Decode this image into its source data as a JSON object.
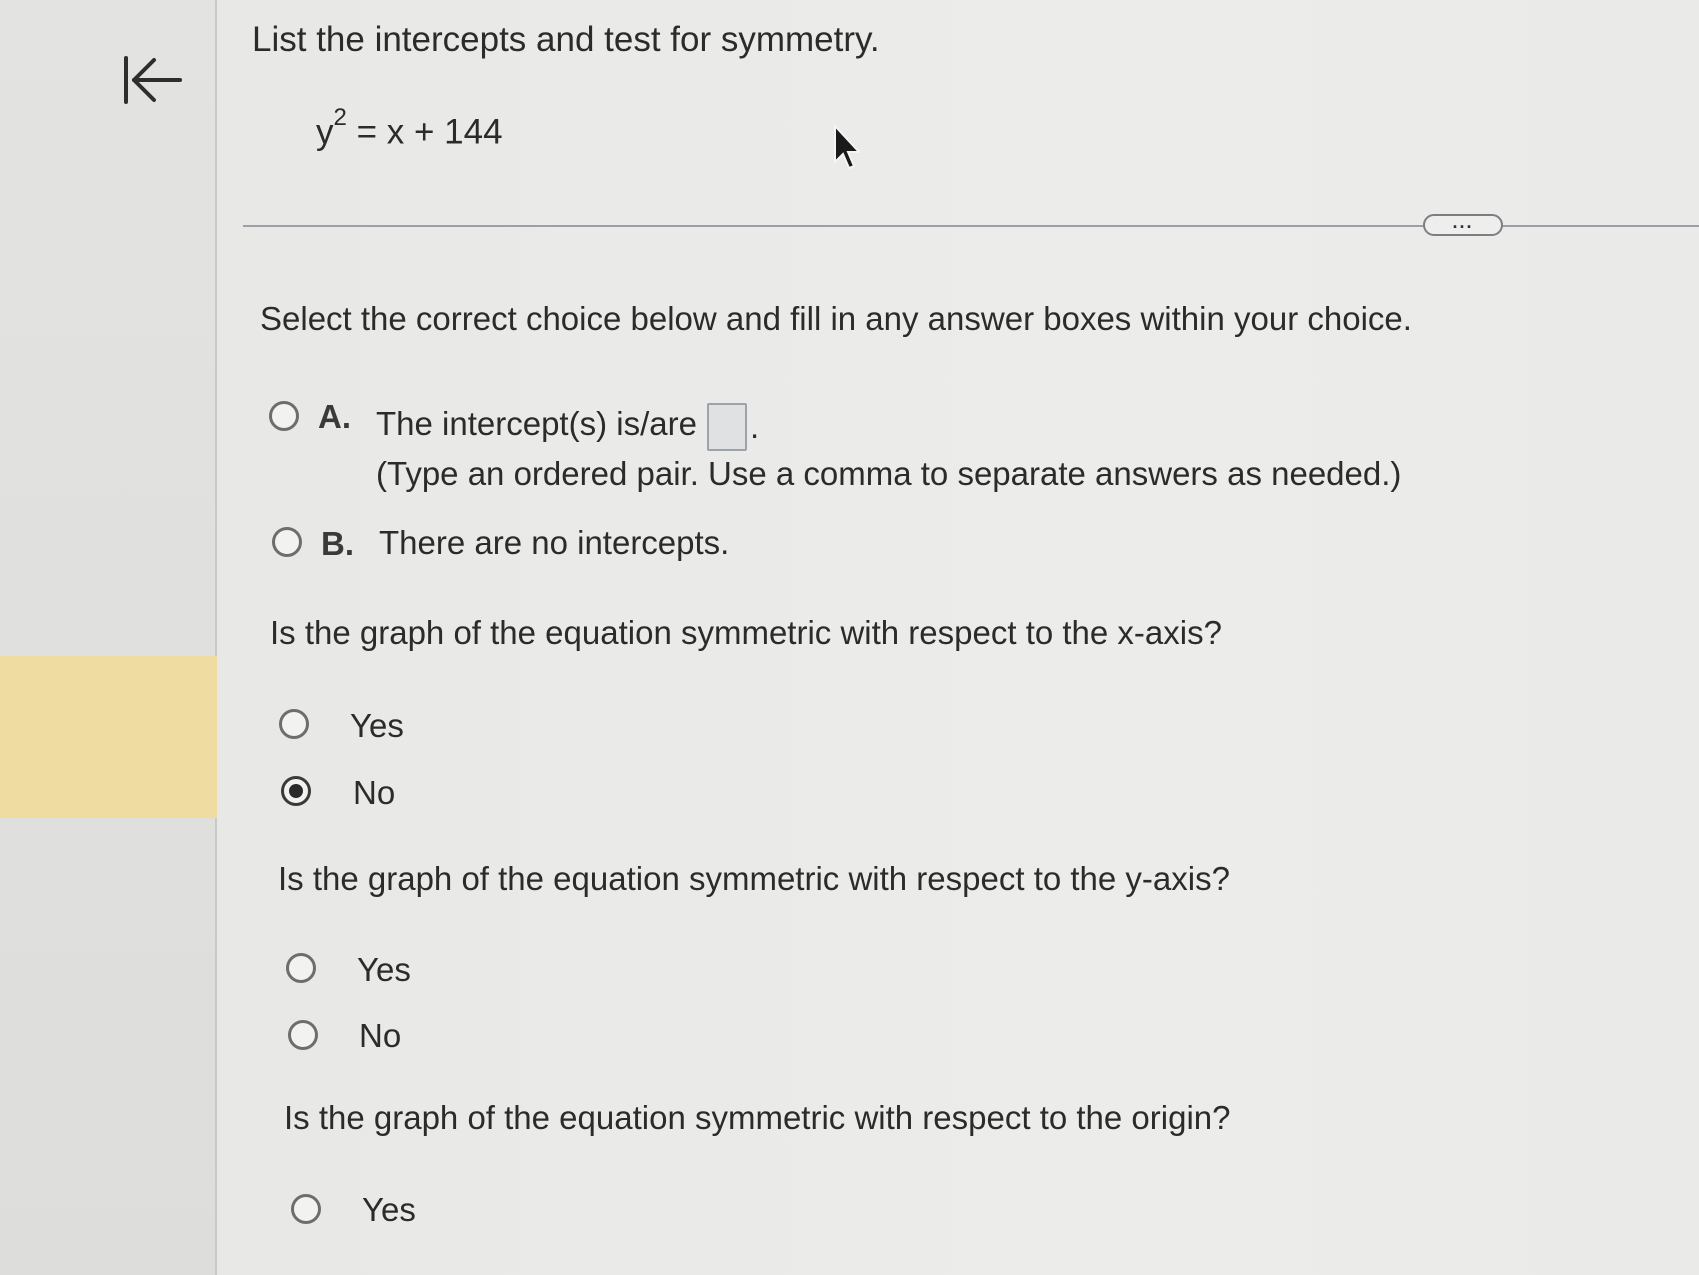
{
  "question": {
    "title": "List the intercepts and test for symmetry.",
    "equation": {
      "lhs": "y",
      "exponent": "2",
      "rhs": "= x + 144"
    }
  },
  "more_button": {
    "label": "..."
  },
  "instructions": "Select the correct choice below and fill in any answer boxes within your choice.",
  "intercept_choices": {
    "a": {
      "letter": "A.",
      "text": "The intercept(s) is/are",
      "suffix": ".",
      "hint": "(Type an ordered pair.  Use a comma to separate answers as needed.)"
    },
    "b": {
      "letter": "B.",
      "text": "There are no intercepts."
    }
  },
  "x_axis": {
    "question": "Is the graph of the equation symmetric with respect to the x-axis?",
    "yes": "Yes",
    "no": "No",
    "selected": "No"
  },
  "y_axis": {
    "question": "Is the graph of the equation symmetric with respect to the y-axis?",
    "yes": "Yes",
    "no": "No",
    "selected": null
  },
  "origin": {
    "question": "Is the graph of the equation symmetric with respect to the origin?",
    "yes": "Yes",
    "selected": null
  },
  "icons": {
    "collapse": "collapse-left-arrow-icon",
    "cursor": "mouse-pointer-icon"
  },
  "colors": {
    "highlight": "#efdca0",
    "radio_border": "#6d6d6d",
    "selected_dot": "#2a2a2a"
  }
}
